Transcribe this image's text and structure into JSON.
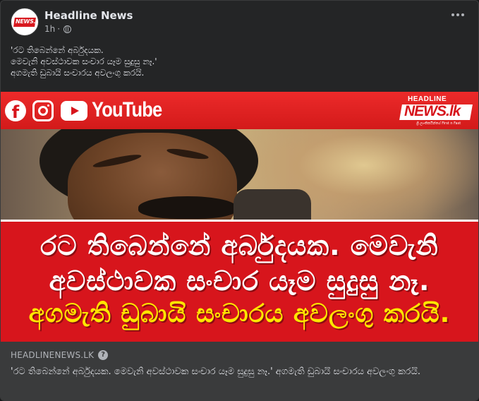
{
  "post": {
    "page_name": "Headline News",
    "time": "1h",
    "separator": "·",
    "text_lines": [
      "'රට තිබෙන්නේ අර්බුදයක.",
      "මෙවැනි අවස්ථාවක සංචාර යෑම සුදුසු නෑ.'",
      "අගමැති ඩුබායි සංචාරය අවලංගු කරයි."
    ]
  },
  "avatar": {
    "logo_text": "NEWS.lk"
  },
  "image": {
    "social_text": "YouTube",
    "brand_top": "HEADLINE",
    "brand_news": "NEWS.lk",
    "brand_tag": "ශ්‍රී ලාංකිකයින්ගේ First n Fast",
    "banner_lines": [
      "රට තිබෙන්නේ අර්බුදයක. මෙවැනි",
      "අවස්ථාවක සංචාර යෑම සුදුසු නෑ.",
      "අගමැති ඩුබායි සංචාරය අවලංගු කරයි."
    ]
  },
  "link": {
    "domain": "HEADLINENEWS.LK",
    "help_glyph": "?",
    "title": "'රට තිබෙන්නේ අර්බුදයක. මෙවැනි අවස්ථාවක සංචාර යෑම සුදුසු නෑ.' අගමැති ඩුබායි සංචාරය අවලංගු කරයි."
  },
  "icons": {
    "globe": "globe-icon",
    "more": "more-options-icon",
    "facebook": "facebook-icon",
    "instagram": "instagram-icon",
    "youtube": "youtube-icon",
    "help": "help-icon"
  },
  "colors": {
    "background": "#242526",
    "text": "#e4e6eb",
    "secondary_text": "#b0b3b8",
    "brand_red": "#d7151c",
    "banner_yellow": "#ffe600"
  }
}
